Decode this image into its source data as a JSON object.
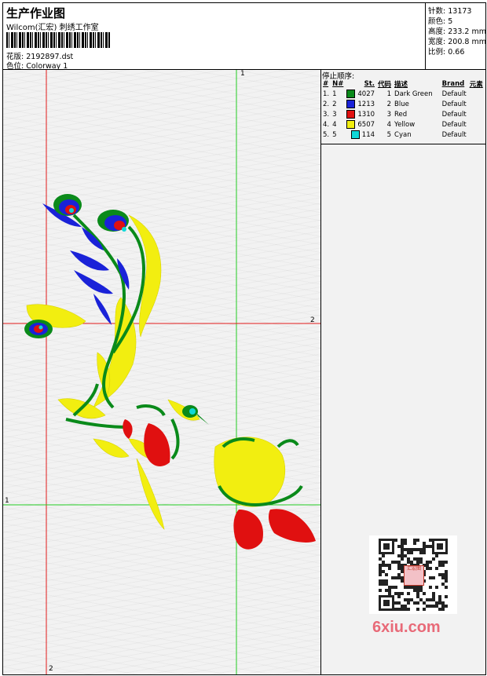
{
  "header": {
    "title": "生产作业图",
    "company": "Wilcom(汇宏) 刺绣工作室",
    "design_label": "花版:",
    "design_value": "2192897.dst",
    "colorway_label": "色位:",
    "colorway_value": "Colorway 1"
  },
  "stats": {
    "stitches_label": "针数:",
    "stitches": "13173",
    "colors_label": "颜色:",
    "colors": "5",
    "height_label": "高度:",
    "height": "233.2 mm",
    "width_label": "宽度:",
    "width": "200.8 mm",
    "scale_label": "比例:",
    "scale": "0.66"
  },
  "stop_sequence": {
    "title": "停止顺序:",
    "headers": [
      "#",
      "N#",
      "St.",
      "代码",
      "描述",
      "Brand",
      "元素"
    ],
    "rows": [
      {
        "num": "1.",
        "n": "1",
        "color": "#0a8a1a",
        "st": "4027",
        "code": "1",
        "desc": "Dark Green",
        "brand": "Default"
      },
      {
        "num": "2.",
        "n": "2",
        "color": "#1a22d8",
        "st": "1213",
        "code": "2",
        "desc": "Blue",
        "brand": "Default"
      },
      {
        "num": "3.",
        "n": "3",
        "color": "#e01010",
        "st": "1310",
        "code": "3",
        "desc": "Red",
        "brand": "Default"
      },
      {
        "num": "4.",
        "n": "4",
        "color": "#f2ee10",
        "st": "6507",
        "code": "4",
        "desc": "Yellow",
        "brand": "Default"
      },
      {
        "num": "5.",
        "n": "5",
        "color": "#10d8d8",
        "st": "114",
        "code": "5",
        "desc": "Cyan",
        "brand": "Default"
      }
    ]
  },
  "guides": {
    "v_top_label": "1",
    "h_red_label": "2",
    "h_green_label": "1",
    "v_red_label": "2"
  },
  "qr_center_text": "汇宏图",
  "watermark": "6xiu.com",
  "colors": {
    "guide_red": "#e21a1a",
    "guide_green": "#22cc22",
    "thread_green": "#0a8a1a",
    "thread_blue": "#1a22d8",
    "thread_red": "#e01010",
    "thread_yellow": "#f2ee10",
    "thread_cyan": "#10d8d8"
  }
}
